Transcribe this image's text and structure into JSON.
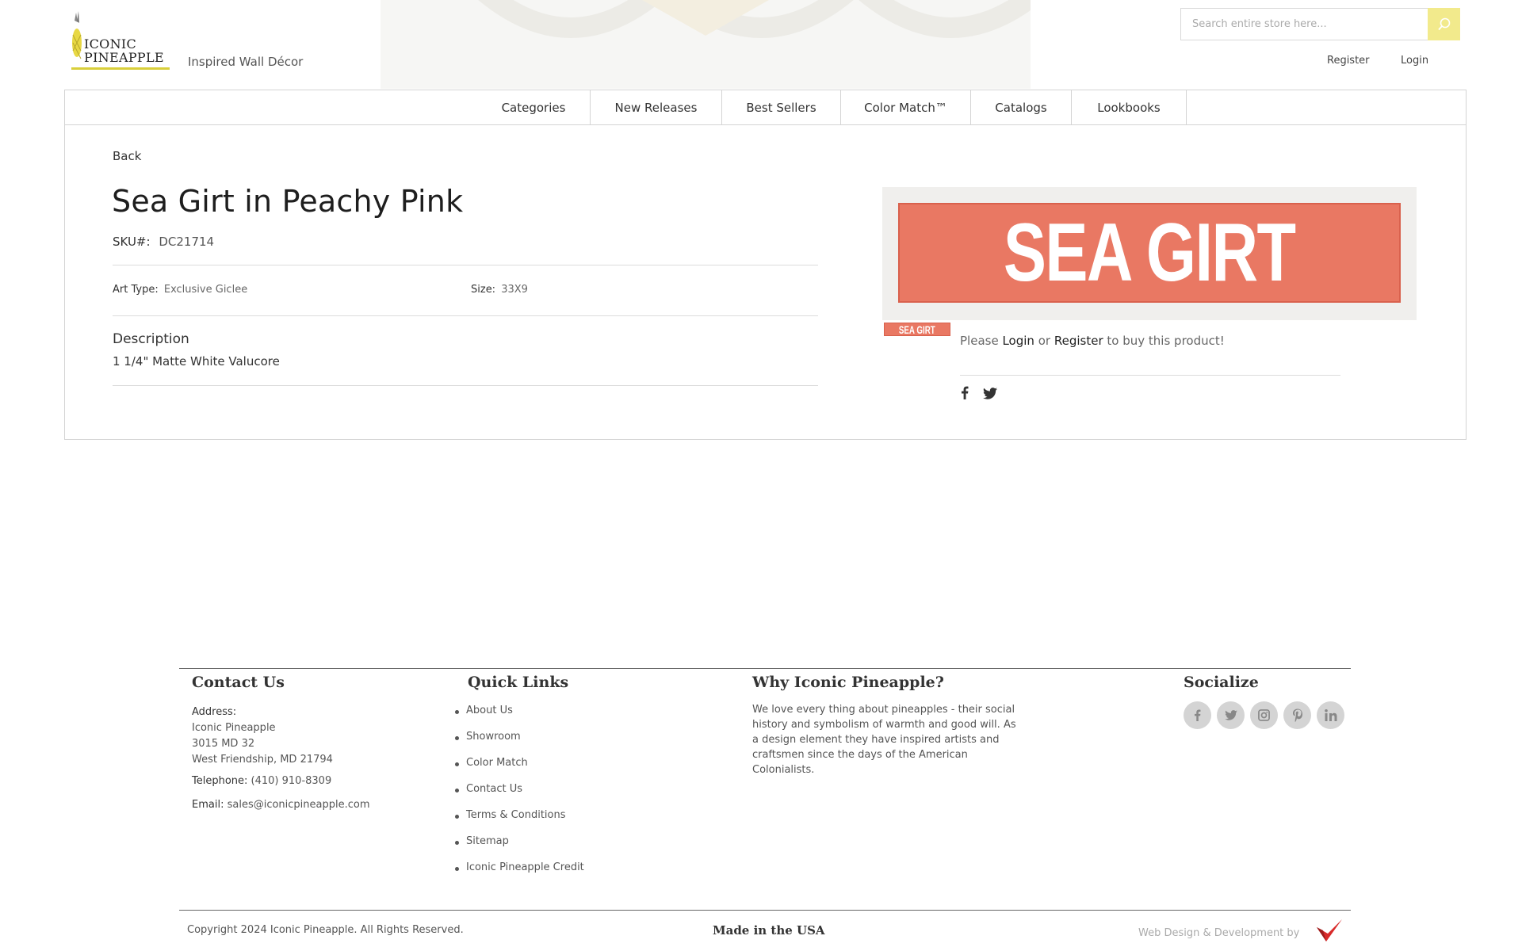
{
  "brand": {
    "logo_line1": "ICONIC",
    "logo_line2": "PINEAPPLE",
    "tagline": "Inspired Wall Décor",
    "accent_color": "#d9cf3a"
  },
  "search": {
    "placeholder": "Search entire store here..."
  },
  "header_links": {
    "register": "Register",
    "login": "Login"
  },
  "nav": {
    "items": [
      "Categories",
      "New Releases",
      "Best Sellers",
      "Color Match™",
      "Catalogs",
      "Lookbooks"
    ]
  },
  "product": {
    "back_label": "Back",
    "title": "Sea Girt in Peachy Pink",
    "sku_label": "SKU#:",
    "sku": "DC21714",
    "art_type_label": "Art Type:",
    "art_type": "Exclusive Giclee",
    "size_label": "Size:",
    "size": "33X9",
    "description_heading": "Description",
    "description": "1 1/4\" Matte White Valucore",
    "image_text": "SEA GIRT",
    "thumb_text": "SEA GIRT",
    "image_color": "#e97863",
    "buy_prefix": "Please",
    "buy_login": "Login",
    "buy_or": "or",
    "buy_register": "Register",
    "buy_suffix": "to buy this product!",
    "share_icons": [
      "facebook-icon",
      "twitter-icon"
    ]
  },
  "footer": {
    "contact": {
      "heading": "Contact Us",
      "address_label": "Address:",
      "address_lines": [
        "Iconic Pineapple",
        "3015 MD 32",
        "West Friendship, MD 21794"
      ],
      "telephone_label": "Telephone:",
      "telephone": "(410) 910-8309",
      "email_label": "Email:",
      "email": "sales@iconicpineapple.com"
    },
    "quick_links": {
      "heading": "Quick Links",
      "items": [
        "About Us",
        "Showroom",
        "Color Match",
        "Contact Us",
        "Terms & Conditions",
        "Sitemap",
        "Iconic Pineapple Credit"
      ]
    },
    "why": {
      "heading": "Why Iconic Pineapple?",
      "text": "We love every thing about pineapples - their social history and symbolism of warmth and good will. As a design element they have inspired artists and craftsmen since the days of the American Colonialists."
    },
    "socialize": {
      "heading": "Socialize",
      "icons": [
        "facebook-icon",
        "twitter-icon",
        "instagram-icon",
        "pinterest-icon",
        "linkedin-icon"
      ]
    },
    "copyright": "Copyright 2024 Iconic Pineapple. All Rights Reserved.",
    "made_in": "Made in the USA",
    "credit": "Web Design & Development by"
  }
}
